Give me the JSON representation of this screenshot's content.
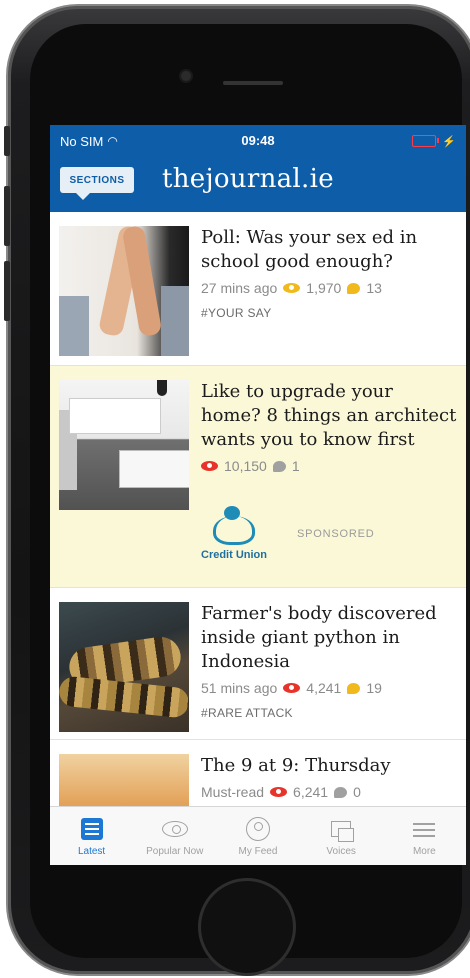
{
  "statusbar": {
    "carrier": "No SIM",
    "time": "09:48"
  },
  "navbar": {
    "sections_label": "SECTIONS",
    "logo": "thejournal.ie"
  },
  "articles": [
    {
      "headline": "Poll: Was your sex ed in school good enough?",
      "time": "27 mins ago",
      "views": "1,970",
      "comments": "13",
      "tag": "#YOUR SAY"
    },
    {
      "headline": "Like to upgrade your home? 8 things an architect wants you to know first",
      "views": "10,150",
      "comments": "1",
      "sponsor_name": "Credit Union",
      "sponsored_label": "SPONSORED"
    },
    {
      "headline": "Farmer's body discovered inside giant python in Indonesia",
      "time": "51 mins ago",
      "views": "4,241",
      "comments": "19",
      "tag": "#RARE ATTACK"
    },
    {
      "headline": "The 9 at 9: Thursday",
      "time": "Must-read",
      "views": "6,241",
      "comments": "0"
    }
  ],
  "tabs": [
    {
      "label": "Latest",
      "icon": "list-icon",
      "active": true
    },
    {
      "label": "Popular Now",
      "icon": "eye-icon"
    },
    {
      "label": "My Feed",
      "icon": "person-icon"
    },
    {
      "label": "Voices",
      "icon": "chat-icon"
    },
    {
      "label": "More",
      "icon": "menu-icon"
    }
  ],
  "colors": {
    "brand_blue": "#0d5da8",
    "sponsored_bg": "#fbf8d8",
    "views_yellow": "#f2b91d",
    "views_red": "#e8332a",
    "active_tab": "#1c78d2"
  }
}
